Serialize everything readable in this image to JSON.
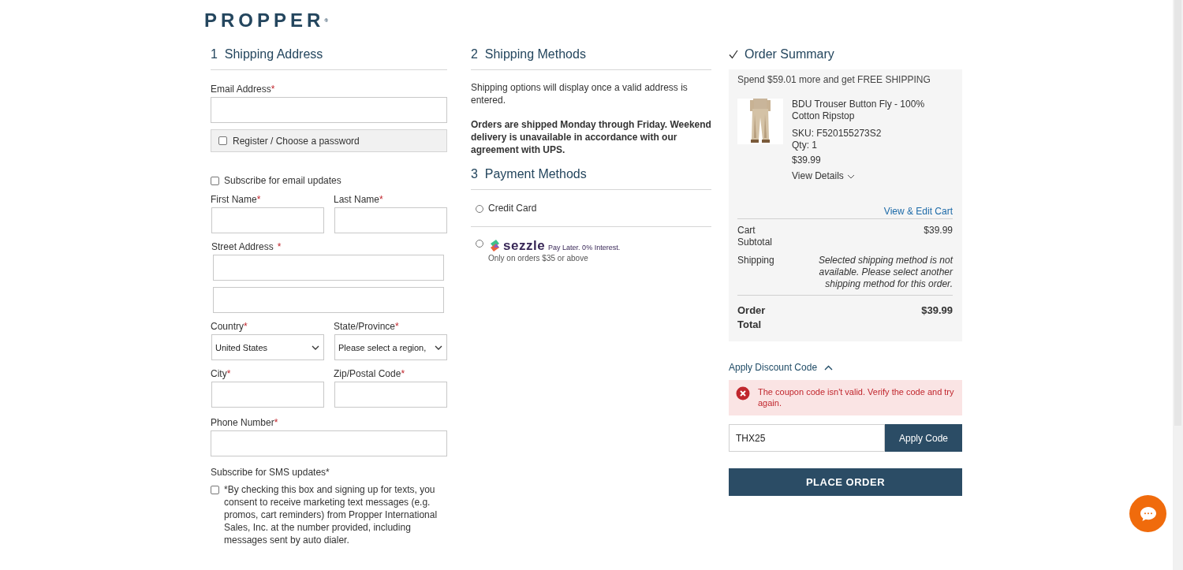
{
  "logo": {
    "text": "PROPPER",
    "mark": "®"
  },
  "shipping_address": {
    "number": "1",
    "title": "Shipping Address",
    "email": {
      "label": "Email Address",
      "marker": "*"
    },
    "register": {
      "label": "Register / Choose a password",
      "checked": false
    },
    "subscribe_email": {
      "label": "Subscribe for email updates",
      "checked": false
    },
    "rows": [
      [
        {
          "kind": "input",
          "label": "First Name",
          "marker": "*"
        },
        {
          "kind": "input",
          "label": "Last Name",
          "marker": "*"
        }
      ],
      [
        {
          "kind": "street",
          "label": "Street Address",
          "marker": "*"
        }
      ],
      [
        {
          "kind": "select",
          "label": "Country",
          "marker": "*",
          "value": "United States"
        },
        {
          "kind": "select",
          "label": "State/Province",
          "marker": "*",
          "value": "Please select a region,"
        }
      ],
      [
        {
          "kind": "input",
          "label": "City",
          "marker": "*"
        },
        {
          "kind": "input",
          "label": "Zip/Postal Code",
          "marker": "*"
        }
      ],
      [
        {
          "kind": "wide",
          "label": "Phone Number",
          "marker": "*"
        }
      ]
    ],
    "sms": {
      "label": "Subscribe for SMS updates*",
      "text": "*By checking this box and signing up for texts, you consent to receive marketing text messages (e.g. promos, cart reminders) from Propper International Sales, Inc. at the number provided, including messages sent by auto dialer.",
      "checked": false
    }
  },
  "shipping_methods": {
    "number": "2",
    "title": "Shipping Methods",
    "note": "Shipping options will display once a valid address is entered.",
    "notice": "Orders are shipped Monday through Friday. Weekend delivery is unavailable in accordance with our agreement with UPS."
  },
  "payment_methods": {
    "number": "3",
    "title": "Payment Methods",
    "options": [
      {
        "kind": "card",
        "label": "Credit Card",
        "selected": false
      },
      {
        "kind": "sezzle",
        "label": "sezzle",
        "tagline": "Pay Later. 0% Interest.",
        "note": "Only on orders $35 or above",
        "selected": false
      }
    ]
  },
  "order_summary": {
    "title": "Order Summary",
    "promo": "Spend $59.01 more and get FREE SHIPPING",
    "item": {
      "name": "BDU Trouser Button Fly - 100% Cotton Ripstop",
      "sku": "SKU: F520155273S2",
      "qty": "Qty: 1",
      "price": "$39.99",
      "details": "View Details"
    },
    "edit_cart": "View & Edit Cart",
    "subtotal": {
      "label": "Cart Subtotal",
      "value": "$39.99"
    },
    "shipping": {
      "label": "Shipping",
      "value": "Selected shipping method is not available. Please select another shipping method for this order."
    },
    "total": {
      "label": "Order Total",
      "value": "$39.99"
    }
  },
  "discount": {
    "title": "Apply Discount Code",
    "expanded": true,
    "error": "The coupon code isn't valid. Verify the code and try again.",
    "code": "THX25",
    "button": "Apply Code"
  },
  "place_order": "PLACE ORDER"
}
